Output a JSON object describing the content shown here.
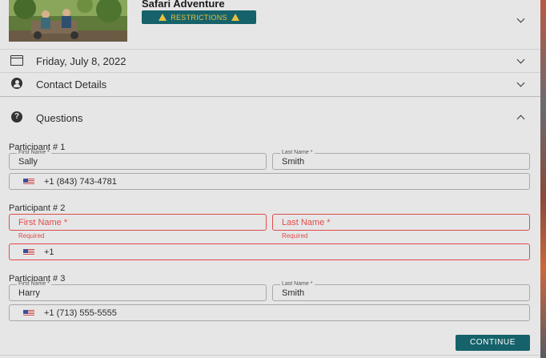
{
  "tour": {
    "title": "Safari Adventure",
    "restrictions_label": "RESTRICTIONS",
    "badge_color": "#15626a",
    "warning_color": "#e9c13e",
    "thumbnail_icon": "tour-photo"
  },
  "sections": {
    "date": {
      "label": "Friday, July 8, 2022",
      "icon": "calendar-icon"
    },
    "contact": {
      "label": "Contact Details",
      "icon": "person-icon"
    },
    "questions": {
      "label": "Questions",
      "icon": "question-icon"
    }
  },
  "participants": [
    {
      "label": "Participant # 1",
      "first_name_label": "First Name *",
      "first_name": "Sally",
      "last_name_label": "Last Name *",
      "last_name": "Smith",
      "phone": "+1 (843) 743-4781"
    },
    {
      "label": "Participant # 2",
      "first_name_placeholder": "First Name *",
      "last_name_placeholder": "Last Name *",
      "first_name_error": "Required",
      "last_name_error": "Required",
      "phone": "+1"
    },
    {
      "label": "Participant # 3",
      "first_name_label": "First Name *",
      "first_name": "Harry",
      "last_name_label": "Last Name *",
      "last_name": "Smith",
      "phone": "+1 (713) 555-5555"
    }
  ],
  "actions": {
    "continue_label": "CONTINUE"
  },
  "colors": {
    "error": "#e24b4b",
    "accent": "#15626a"
  }
}
